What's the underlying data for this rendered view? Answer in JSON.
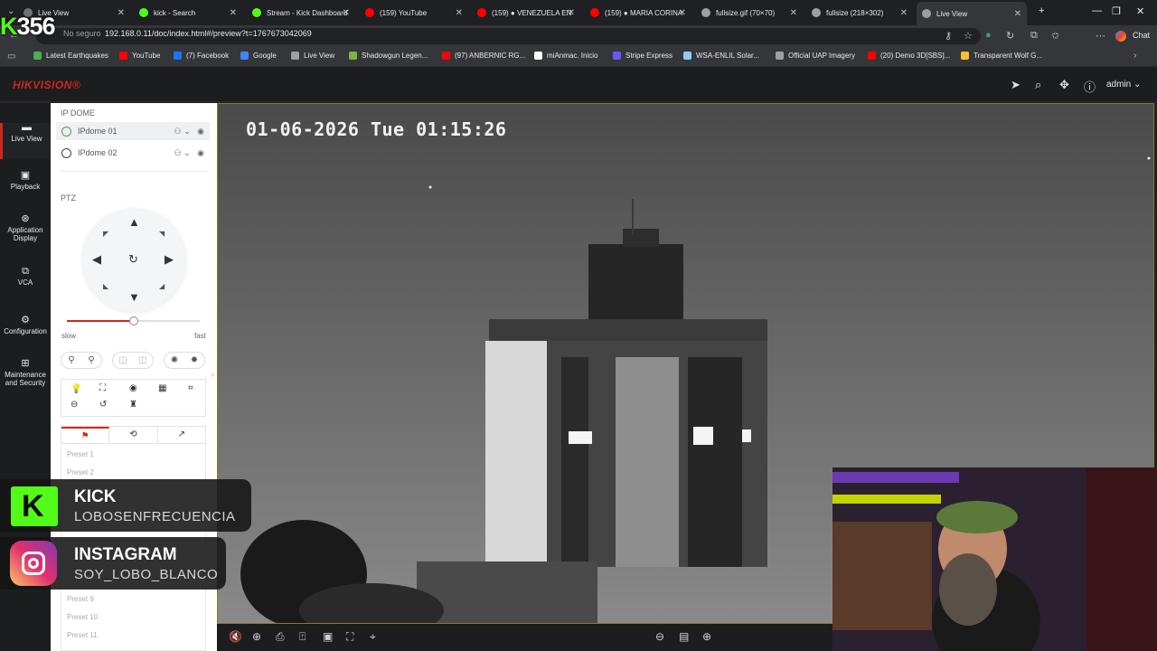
{
  "stream_overlay": {
    "counter_prefix": "K",
    "counter_value": "356",
    "kick": {
      "title": "KICK",
      "handle": "LOBOSENFRECUENCIA"
    },
    "instagram": {
      "title": "INSTAGRAM",
      "handle": "SOY_LOBO_BLANCO"
    }
  },
  "browser": {
    "tabs": [
      {
        "label": "Live View",
        "color": "#6f7378"
      },
      {
        "label": "kick - Search",
        "color": "#53fc18"
      },
      {
        "label": "Stream - Kick Dashboard",
        "color": "#53fc18"
      },
      {
        "label": "(159) YouTube",
        "color": "#ff0000"
      },
      {
        "label": "(159) ● VENEZUELA EN",
        "color": "#ff0000"
      },
      {
        "label": "(159) ● MARIA CORINA",
        "color": "#ff0000"
      },
      {
        "label": "fullsize.gif (70×70)",
        "color": "#9aa0a6"
      },
      {
        "label": "fullsize (218×302)",
        "color": "#9aa0a6"
      },
      {
        "label": "Live View",
        "color": "#9aa0a6"
      }
    ],
    "security_label": "No seguro",
    "url": "192.168.0.11/doc/index.html#/preview?t=1767673042069",
    "chat_label": "Chat",
    "bookmarks": [
      {
        "label": "Latest Earthquakes",
        "color": "#4caf50"
      },
      {
        "label": "YouTube",
        "color": "#ff0000"
      },
      {
        "label": "(7) Facebook",
        "color": "#1877f2"
      },
      {
        "label": "Google",
        "color": "#4285f4"
      },
      {
        "label": "Live View",
        "color": "#9aa0a6"
      },
      {
        "label": "Shadowgun Legen...",
        "color": "#7cb342"
      },
      {
        "label": "(97) ANBERNIC RG...",
        "color": "#ff0000"
      },
      {
        "label": "miAnmac. Inicio",
        "color": "#ffffff"
      },
      {
        "label": "Stripe Express",
        "color": "#635bff"
      },
      {
        "label": "WSA-ENLIL Solar...",
        "color": "#90caf9"
      },
      {
        "label": "Official UAP Imagery",
        "color": "#9aa0a6"
      },
      {
        "label": "(20) Demo 3D[SBS]...",
        "color": "#ff0000"
      },
      {
        "label": "Transparent Wolf G...",
        "color": "#fbc02d"
      }
    ]
  },
  "app": {
    "logo": "HIKVISION®",
    "user": "admin",
    "brand_color": "#d0271c",
    "nav": [
      {
        "label": "Live View",
        "icon": "live-view-icon"
      },
      {
        "label": "Playback",
        "icon": "playback-icon"
      },
      {
        "label": "Application Display",
        "icon": "application-icon"
      },
      {
        "label": "VCA",
        "icon": "vca-icon"
      },
      {
        "label": "Configuration",
        "icon": "gear-icon"
      },
      {
        "label": "Maintenance and Security",
        "icon": "maintenance-icon"
      }
    ]
  },
  "devices": {
    "section_title": "IP DOME",
    "cameras": [
      "IPdome 01",
      "IPdome 02"
    ]
  },
  "ptz": {
    "section_title": "PTZ",
    "speed_level": 0.5,
    "slow_label": "slow",
    "fast_label": "fast",
    "presets": [
      "Preset 1",
      "Preset 2",
      "Preset 9",
      "Preset 10",
      "Preset 11"
    ]
  },
  "video": {
    "osd_text": "01-06-2026 Tue 01:15:26"
  }
}
